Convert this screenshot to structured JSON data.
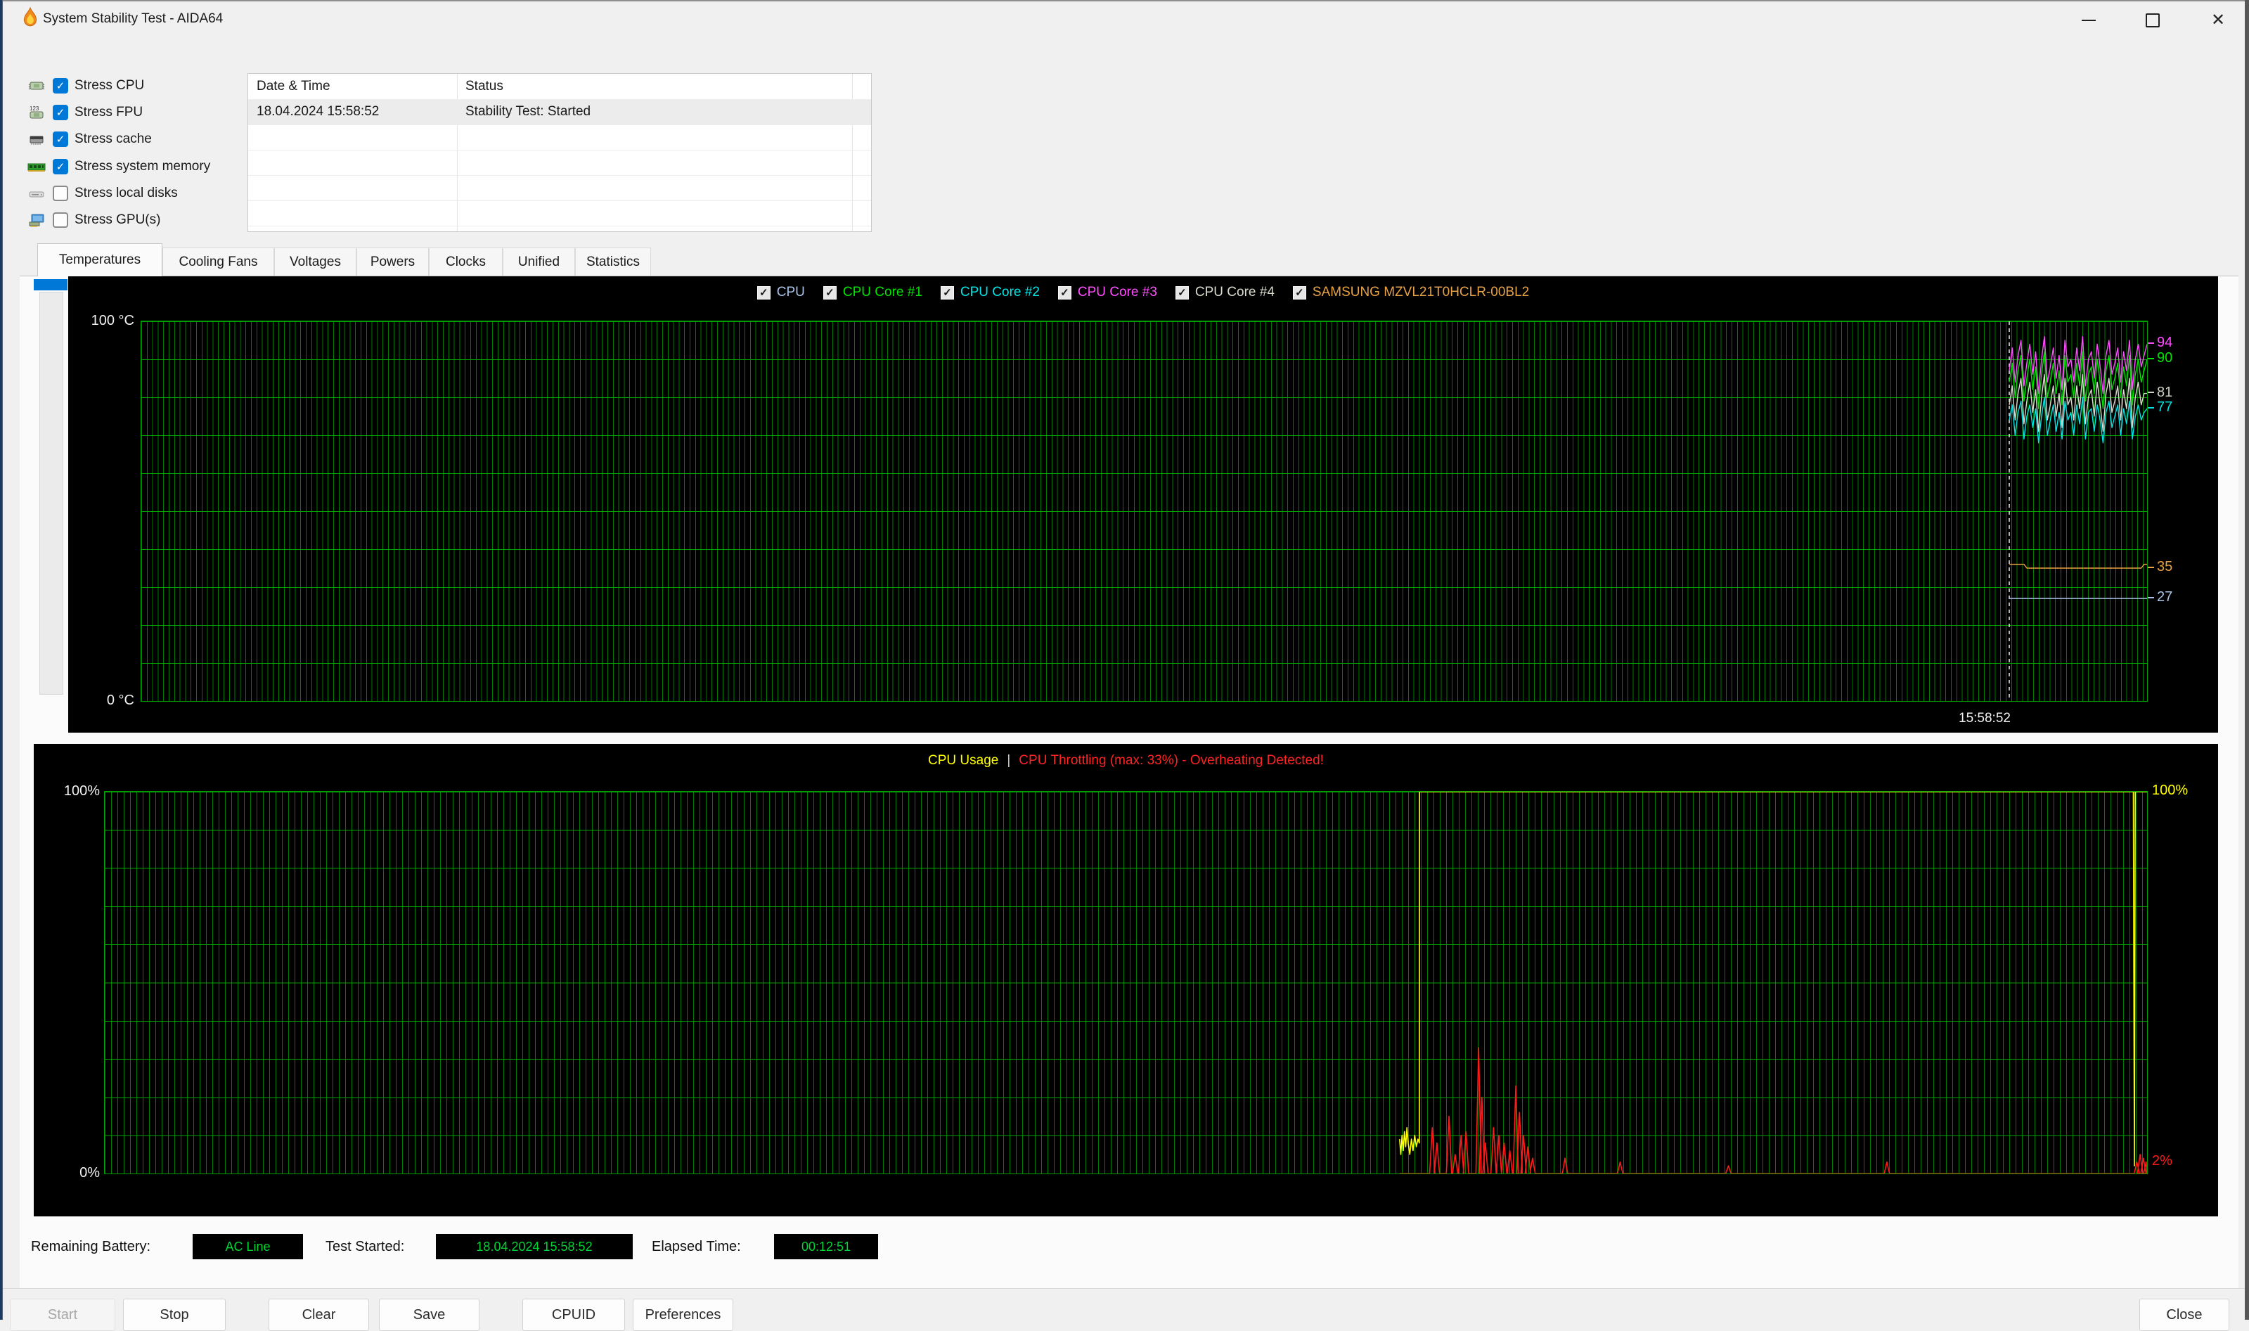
{
  "window": {
    "title": "System Stability Test - AIDA64"
  },
  "stress": {
    "items": [
      {
        "label": "Stress CPU",
        "checked": true
      },
      {
        "label": "Stress FPU",
        "checked": true
      },
      {
        "label": "Stress cache",
        "checked": true
      },
      {
        "label": "Stress system memory",
        "checked": true
      },
      {
        "label": "Stress local disks",
        "checked": false
      },
      {
        "label": "Stress GPU(s)",
        "checked": false
      }
    ]
  },
  "log_table": {
    "columns": [
      "Date & Time",
      "Status"
    ],
    "rows": [
      [
        "18.04.2024 15:58:52",
        "Stability Test: Started"
      ]
    ]
  },
  "tabs": {
    "items": [
      "Temperatures",
      "Cooling Fans",
      "Voltages",
      "Powers",
      "Clocks",
      "Unified",
      "Statistics"
    ],
    "active": "Temperatures"
  },
  "status_bar": {
    "battery_label": "Remaining Battery:",
    "battery_value": "AC Line",
    "started_label": "Test Started:",
    "started_value": "18.04.2024 15:58:52",
    "elapsed_label": "Elapsed Time:",
    "elapsed_value": "00:12:51",
    "value_color": "#00d435"
  },
  "buttons": {
    "start": "Start",
    "start_enabled": false,
    "stop": "Stop",
    "clear": "Clear",
    "save": "Save",
    "cpuid": "CPUID",
    "preferences": "Preferences",
    "close": "Close"
  },
  "chart_data": [
    {
      "type": "line",
      "title": "Temperatures",
      "y_axis": {
        "top_label": "100 °C",
        "bottom_label": "0 °C",
        "min": 0,
        "max": 100,
        "gridline_step": 10
      },
      "x_axis": {
        "start_time_label": "15:58:52",
        "test_start_frac": 0.9313
      },
      "legend": [
        {
          "label": "CPU",
          "color": "#aac4e8"
        },
        {
          "label": "CPU Core #1",
          "color": "#00e400"
        },
        {
          "label": "CPU Core #2",
          "color": "#00e5e5"
        },
        {
          "label": "CPU Core #3",
          "color": "#ff4dff"
        },
        {
          "label": "CPU Core #4",
          "color": "#dadace"
        },
        {
          "label": "SAMSUNG MZVL21T0HCLR-00BL2",
          "color": "#e9a243"
        }
      ],
      "series": [
        {
          "name": "CPU",
          "color": "#aac4e8",
          "current": 27,
          "values": [
            27,
            27,
            27,
            27,
            27,
            27,
            27,
            27,
            27,
            27,
            27,
            27,
            27,
            27,
            27,
            27,
            27,
            27,
            27,
            27,
            27,
            27,
            27,
            27,
            27,
            27,
            27,
            27,
            27,
            27,
            27,
            27,
            27,
            27,
            27,
            27,
            27,
            27,
            27,
            27,
            27,
            27,
            27,
            27,
            27,
            27,
            27,
            27
          ]
        },
        {
          "name": "SAMSUNG MZVL21T0HCLR-00BL2",
          "color": "#e9a243",
          "current": 35,
          "values": [
            36,
            36,
            36,
            36,
            36,
            36,
            35,
            35,
            35,
            35,
            35,
            35,
            35,
            35,
            35,
            35,
            35,
            35,
            35,
            35,
            35,
            35,
            35,
            35,
            35,
            35,
            35,
            35,
            35,
            35,
            35,
            35,
            35,
            35,
            35,
            35,
            35,
            35,
            35,
            35,
            35,
            35,
            35,
            35,
            35,
            35,
            36,
            36
          ]
        },
        {
          "name": "CPU Core #4",
          "color": "#dadace",
          "current": 81,
          "values": [
            78,
            83,
            74,
            81,
            85,
            73,
            79,
            84,
            76,
            82,
            71,
            80,
            86,
            74,
            78,
            83,
            75,
            81,
            72,
            85,
            78,
            80,
            74,
            83,
            77,
            86,
            73,
            80,
            82,
            75,
            84,
            78,
            71,
            81,
            85,
            76,
            79,
            83,
            74,
            82,
            77,
            85,
            72,
            80,
            84,
            78,
            81,
            81
          ]
        },
        {
          "name": "CPU Core #1",
          "color": "#00e400",
          "current": 90,
          "values": [
            84,
            89,
            80,
            87,
            91,
            79,
            85,
            90,
            82,
            88,
            77,
            86,
            92,
            80,
            84,
            89,
            81,
            87,
            78,
            91,
            84,
            86,
            80,
            89,
            83,
            92,
            79,
            86,
            88,
            81,
            90,
            84,
            77,
            87,
            91,
            82,
            85,
            89,
            80,
            88,
            83,
            91,
            78,
            86,
            90,
            84,
            87,
            90
          ]
        },
        {
          "name": "CPU Core #2",
          "color": "#00e5e5",
          "current": 77,
          "values": [
            74,
            78,
            70,
            76,
            79,
            69,
            75,
            78,
            72,
            77,
            68,
            75,
            80,
            70,
            74,
            78,
            71,
            76,
            69,
            79,
            74,
            76,
            70,
            78,
            73,
            80,
            69,
            76,
            77,
            71,
            78,
            74,
            68,
            76,
            79,
            72,
            75,
            78,
            70,
            77,
            73,
            79,
            69,
            75,
            78,
            74,
            76,
            77
          ]
        },
        {
          "name": "CPU Core #3",
          "color": "#ff4dff",
          "current": 94,
          "values": [
            87,
            93,
            84,
            91,
            95,
            83,
            89,
            94,
            86,
            92,
            81,
            90,
            96,
            84,
            88,
            93,
            85,
            91,
            82,
            95,
            88,
            90,
            84,
            93,
            87,
            96,
            83,
            90,
            92,
            85,
            94,
            88,
            81,
            91,
            95,
            86,
            89,
            93,
            84,
            92,
            87,
            95,
            82,
            90,
            94,
            88,
            91,
            94
          ]
        }
      ],
      "right_labels": [
        {
          "text": "94",
          "value": 94,
          "color": "#ff4dff"
        },
        {
          "text": "90",
          "value": 90,
          "color": "#00e400"
        },
        {
          "text": "81",
          "value": 81,
          "color": "#cfcfc2"
        },
        {
          "text": "77",
          "value": 77,
          "color": "#00e5e5"
        },
        {
          "text": "35",
          "value": 35,
          "color": "#e9a243"
        },
        {
          "text": "27",
          "value": 27,
          "color": "#aac4e8"
        }
      ]
    },
    {
      "type": "line",
      "title_parts": [
        {
          "text": "CPU Usage",
          "color": "#ffff00"
        },
        {
          "text": "|",
          "color": "#cccccc"
        },
        {
          "text": "CPU Throttling (max: 33%) - Overheating Detected!",
          "color": "#ff2222"
        }
      ],
      "y_axis": {
        "top_label": "100%",
        "bottom_label": "0%",
        "min": 0,
        "max": 100,
        "gridline_step": 10
      },
      "series": [
        {
          "name": "CPU Usage",
          "color": "#ffff00",
          "right_label": {
            "text": "100%",
            "value": 100
          },
          "points": [
            [
              0.634,
              9
            ],
            [
              0.6346,
              5
            ],
            [
              0.6352,
              10
            ],
            [
              0.6358,
              6
            ],
            [
              0.6364,
              11
            ],
            [
              0.637,
              7
            ],
            [
              0.6376,
              12
            ],
            [
              0.6382,
              8
            ],
            [
              0.639,
              5
            ],
            [
              0.6398,
              9
            ],
            [
              0.6406,
              6
            ],
            [
              0.6414,
              10
            ],
            [
              0.6422,
              7
            ],
            [
              0.643,
              9
            ],
            [
              0.6437,
              8
            ],
            [
              0.6438,
              100
            ],
            [
              0.9933,
              100
            ],
            [
              0.9936,
              35
            ],
            [
              0.9938,
              2
            ],
            [
              0.9942,
              100
            ],
            [
              1,
              100
            ]
          ]
        },
        {
          "name": "CPU Throttling",
          "color": "#ff1a1a",
          "max_throttle_pct": 33,
          "right_label": {
            "text": "2%",
            "value": 3
          },
          "baseline": 0,
          "start_frac": 0.634,
          "end_value": 2,
          "spikes": [
            [
              0.65,
              12
            ],
            [
              0.6523,
              8
            ],
            [
              0.6582,
              15
            ],
            [
              0.6612,
              5
            ],
            [
              0.6641,
              10
            ],
            [
              0.6665,
              11
            ],
            [
              0.6727,
              33
            ],
            [
              0.6743,
              20
            ],
            [
              0.676,
              8
            ],
            [
              0.68,
              12
            ],
            [
              0.6826,
              10
            ],
            [
              0.6852,
              8
            ],
            [
              0.688,
              6
            ],
            [
              0.6909,
              23
            ],
            [
              0.6927,
              16
            ],
            [
              0.6947,
              10
            ],
            [
              0.6968,
              7
            ],
            [
              0.6991,
              4
            ],
            [
              0.715,
              4
            ],
            [
              0.742,
              3
            ],
            [
              0.795,
              2
            ],
            [
              0.8726,
              3
            ],
            [
              0.995,
              3
            ],
            [
              0.9966,
              5
            ],
            [
              0.9982,
              4
            ],
            [
              0.9996,
              3
            ]
          ]
        }
      ]
    }
  ]
}
